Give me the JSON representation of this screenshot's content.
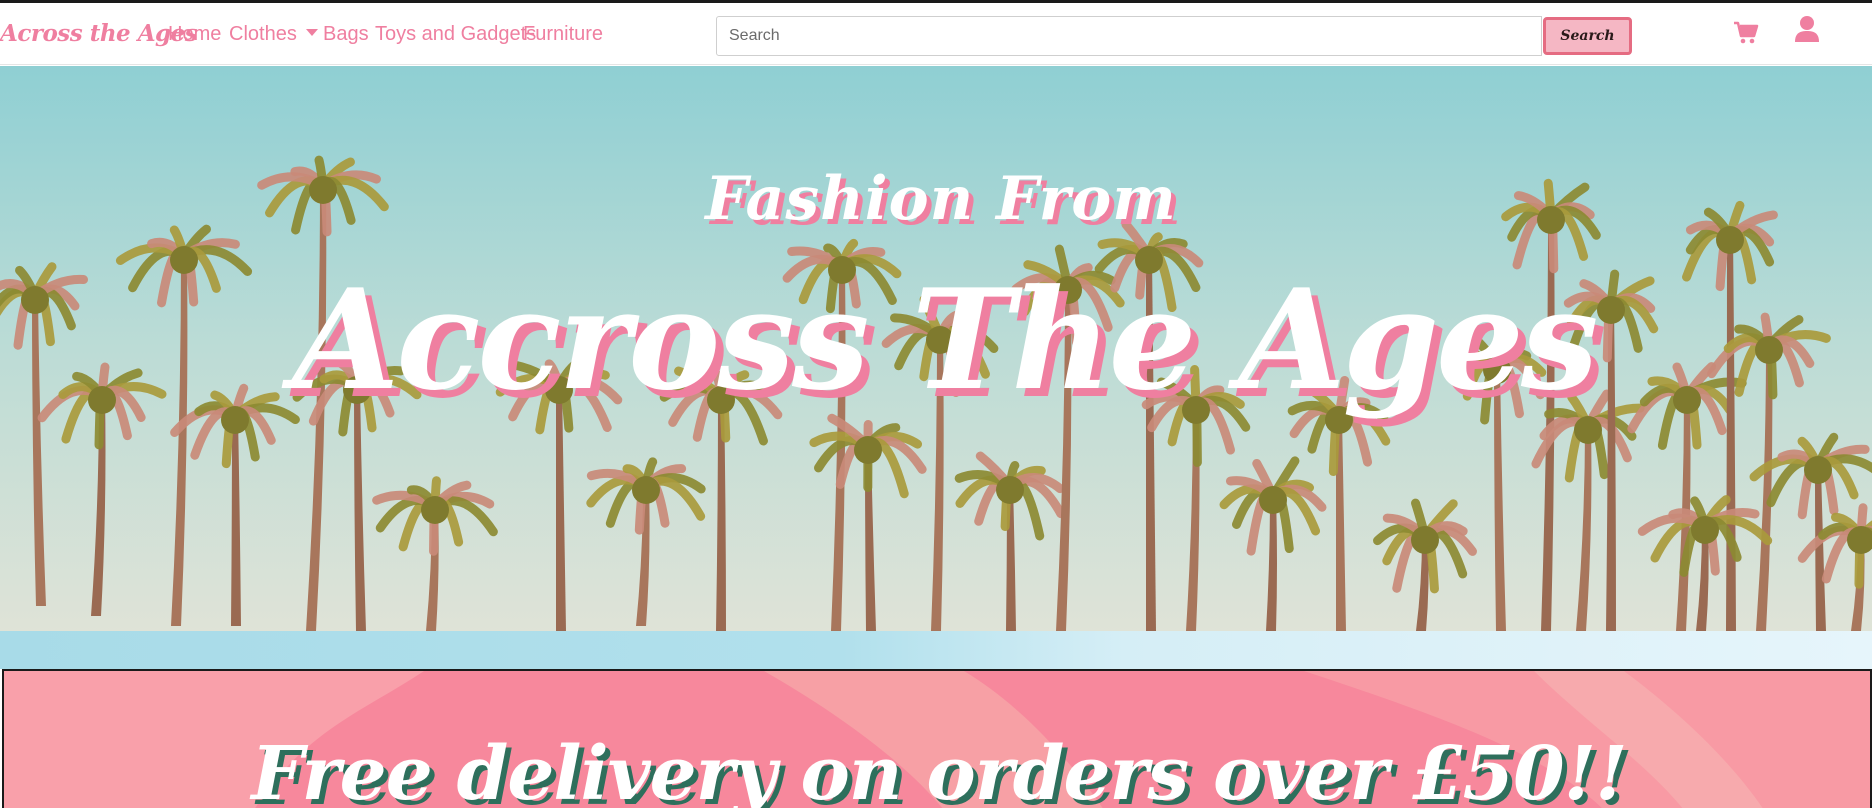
{
  "navbar": {
    "brand": "Across the Ages",
    "links": [
      {
        "label": "Home"
      },
      {
        "label": "Clothes"
      },
      {
        "label": "Bags"
      },
      {
        "label": "Toys and Gadgets"
      },
      {
        "label": "Furniture"
      }
    ],
    "search": {
      "placeholder": "Search",
      "value": "",
      "button_label": "Search"
    },
    "icons": {
      "cart": "shopping-cart-icon",
      "user": "user-icon"
    }
  },
  "hero": {
    "subtitle": "Fashion From",
    "title": "Accross The Ages"
  },
  "banner": {
    "text": "Free delivery on orders over £50!!"
  },
  "colors": {
    "accent": "#ef7fa0",
    "search_button_bg": "#f5b7c4",
    "search_button_border": "#e56c82",
    "banner_bg": "#f7889c",
    "banner_shadow": "#2e6f5c"
  }
}
